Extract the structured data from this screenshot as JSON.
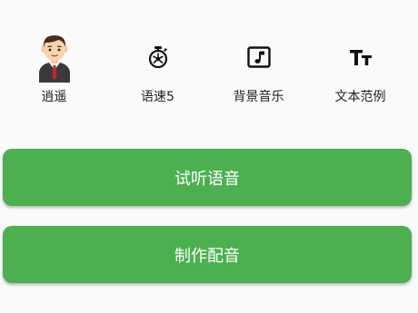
{
  "colors": {
    "accent": "#4caf50",
    "button_text": "#ffffff",
    "label_text": "#222222",
    "background": "#fafafa"
  },
  "toolbar": {
    "items": [
      {
        "icon": "avatar-businessman-icon",
        "label": "逍遥"
      },
      {
        "icon": "stopwatch-icon",
        "label": "语速5"
      },
      {
        "icon": "music-note-icon",
        "label": "背景音乐"
      },
      {
        "icon": "text-size-icon",
        "label": "文本范例"
      }
    ]
  },
  "actions": {
    "preview_label": "试听语音",
    "produce_label": "制作配音"
  }
}
